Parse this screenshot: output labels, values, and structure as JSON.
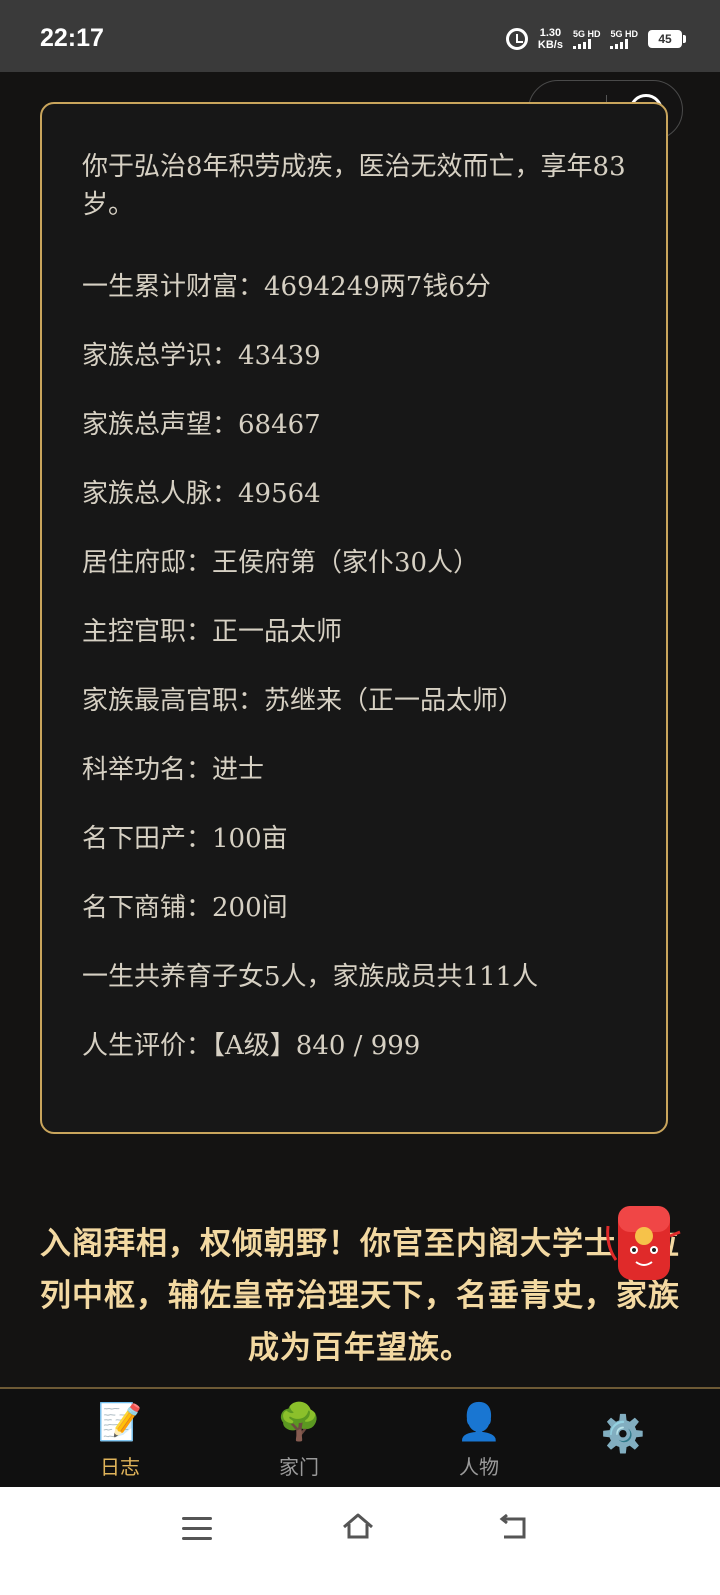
{
  "status_bar": {
    "time": "22:17",
    "speed_value": "1.30",
    "speed_unit": "KB/s",
    "sim1": "5G HD",
    "sim2": "5G HD",
    "battery": "45"
  },
  "summary_lines": [
    "你于弘治8年积劳成疾，医治无效而亡，享年83岁。",
    "一生累计财富：4694249两7钱6分",
    "家族总学识：43439",
    "家族总声望：68467",
    "家族总人脉：49564",
    "居住府邸：王侯府第（家仆30人）",
    "主控官职：正一品太师",
    "家族最高官职：苏继来（正一品太师）",
    "科举功名：进士",
    "名下田产：100亩",
    "名下商铺：200间",
    "一生共养育子女5人，家族成员共111人",
    "人生评价：【A级】840 / 999"
  ],
  "ending_text": "入阁拜相，权倾朝野！你官至内阁大学士，位列中枢，辅佐皇帝治理天下，名垂青史，家族成为百年望族。",
  "tabs": [
    {
      "label": "日志",
      "icon": "memo-icon",
      "active": true
    },
    {
      "label": "家门",
      "icon": "tree-icon",
      "active": false
    },
    {
      "label": "人物",
      "icon": "person-icon",
      "active": false
    },
    {
      "label": "",
      "icon": "gear-icon",
      "active": false
    }
  ],
  "colors": {
    "accent_gold": "#c9a55c",
    "ending_text": "#f3d9a2",
    "active_tab": "#e0b45a",
    "background": "#141312"
  }
}
